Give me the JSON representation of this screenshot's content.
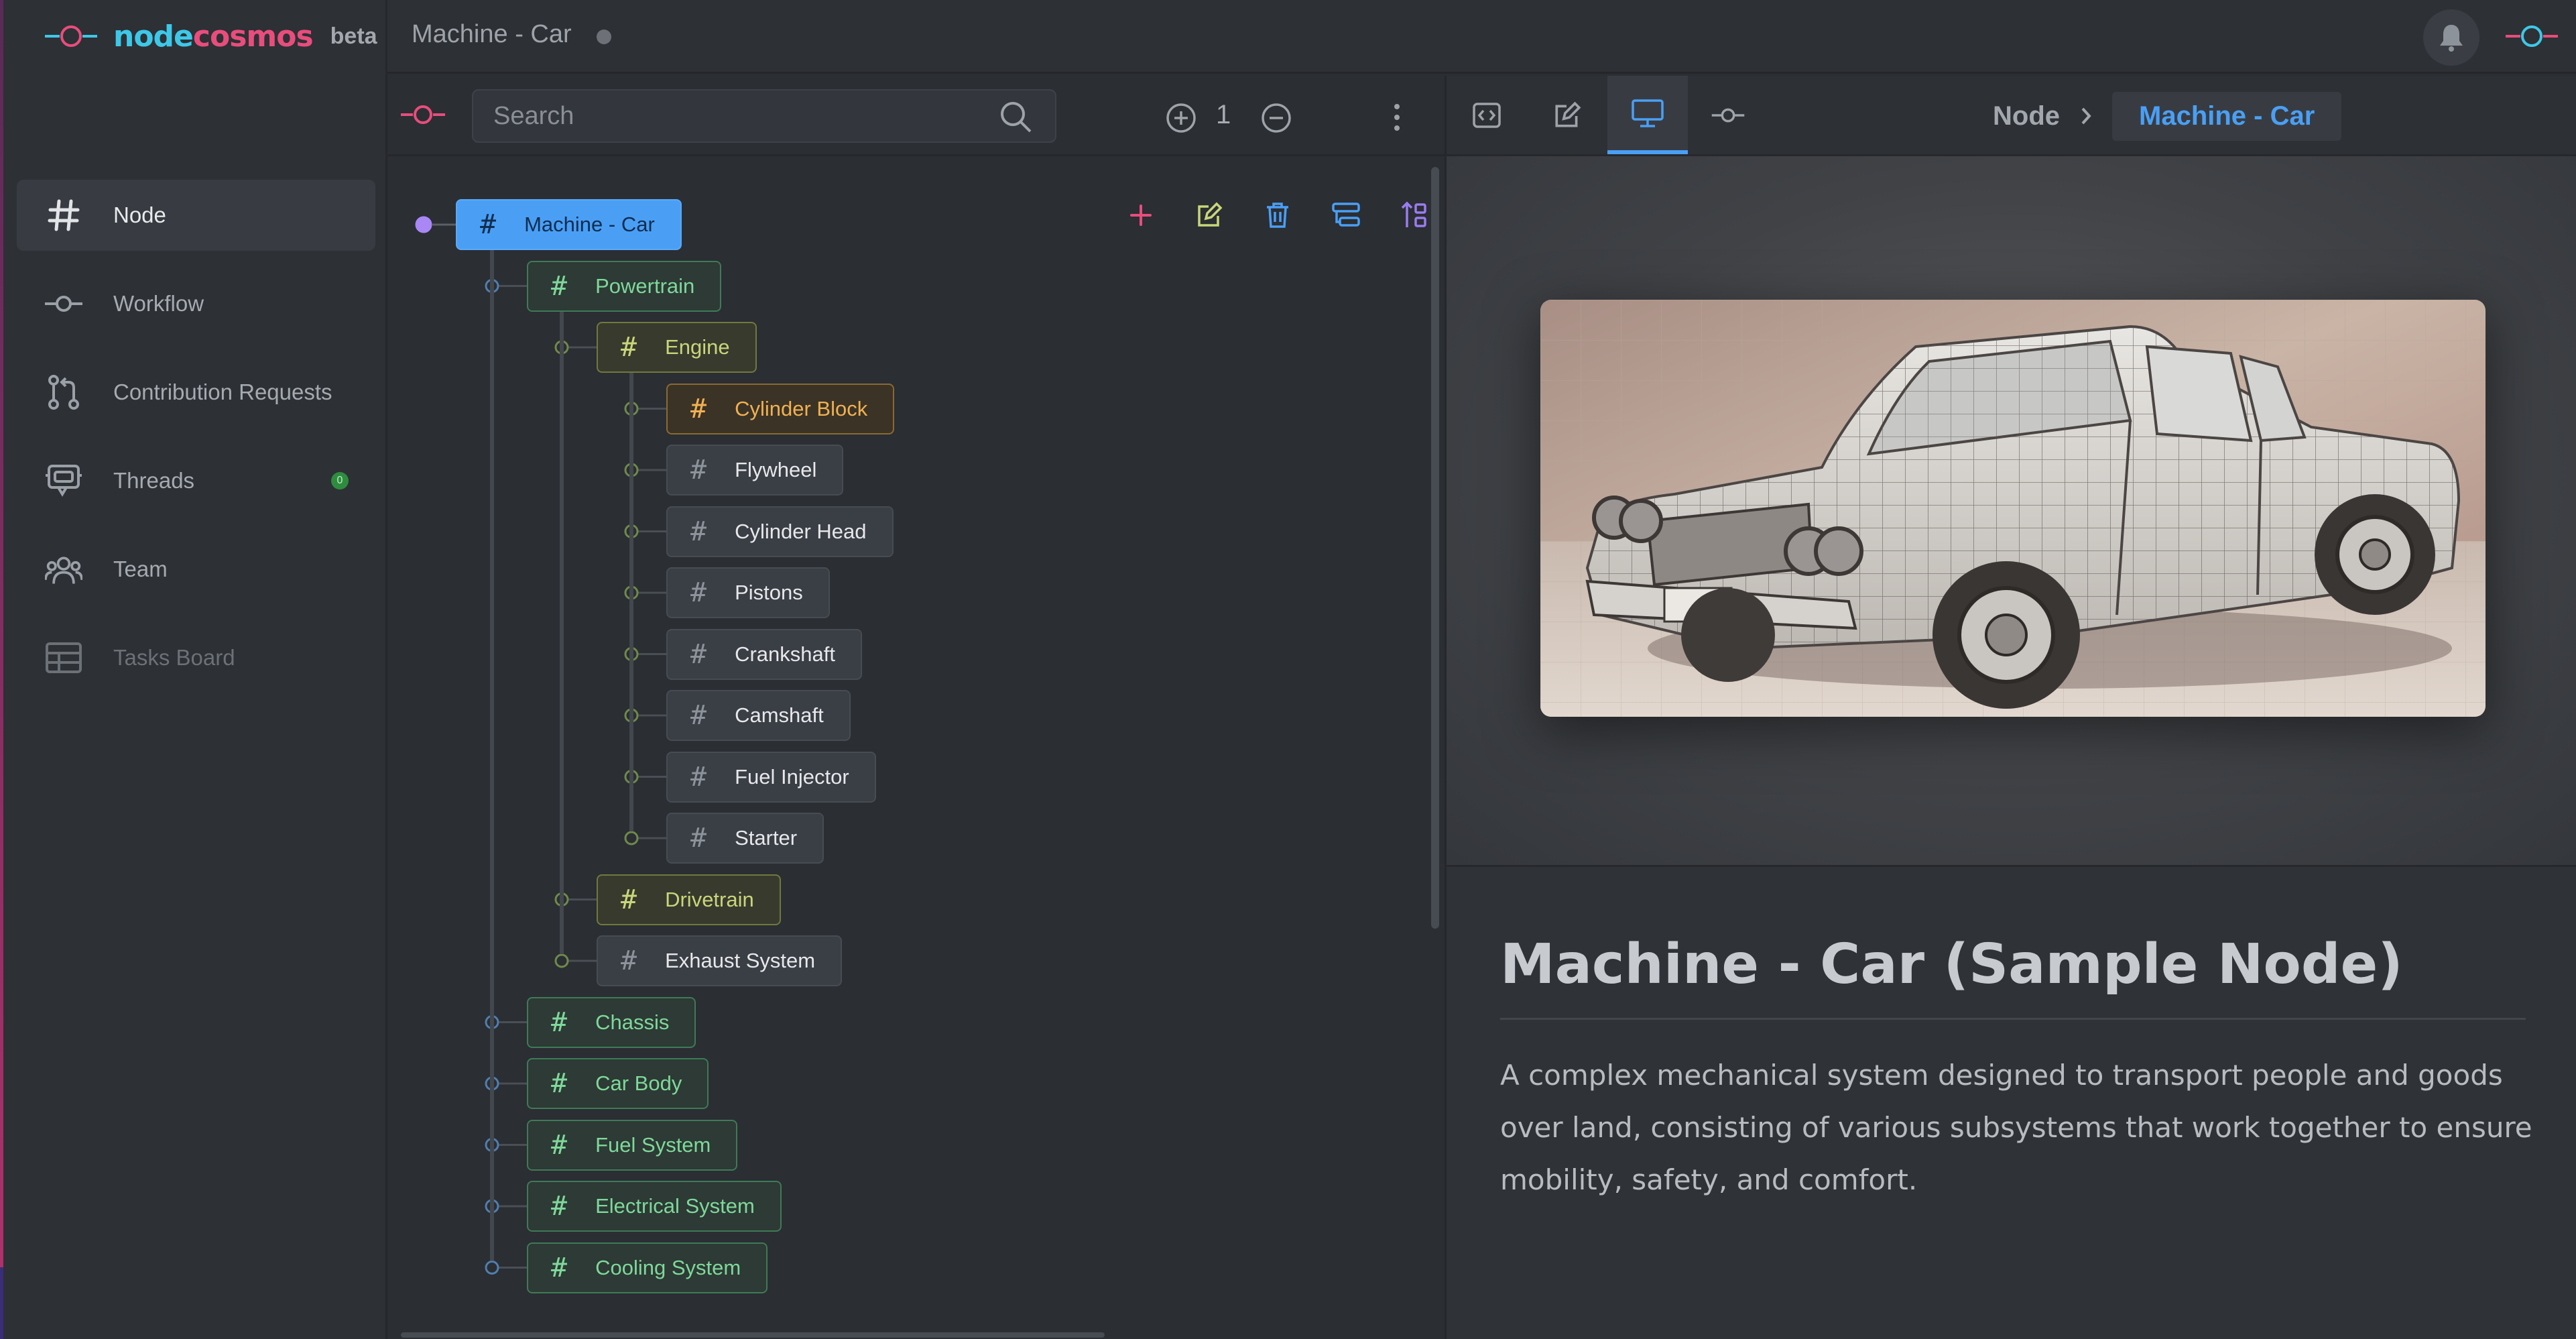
{
  "app": {
    "brand_part1": "node",
    "brand_part2": "cosmos",
    "beta_label": "beta",
    "window_title": "Machine - Car"
  },
  "sidebar": {
    "items": [
      {
        "label": "Node",
        "icon": "hash-icon",
        "active": true
      },
      {
        "label": "Workflow",
        "icon": "workflow-icon"
      },
      {
        "label": "Contribution Requests",
        "icon": "git-pull-request-icon"
      },
      {
        "label": "Threads",
        "icon": "chat-bubble-icon",
        "badge": "0"
      },
      {
        "label": "Team",
        "icon": "team-icon"
      },
      {
        "label": "Tasks Board",
        "icon": "table-icon",
        "disabled": true
      }
    ]
  },
  "tree": {
    "search_placeholder": "Search",
    "zoom_level": "1",
    "hash": "#",
    "root": "Machine - Car",
    "like_count": "1",
    "nodes": [
      {
        "label": "Powertrain",
        "depth": 1,
        "style": "green"
      },
      {
        "label": "Engine",
        "depth": 2,
        "style": "olive"
      },
      {
        "label": "Cylinder Block",
        "depth": 3,
        "style": "orange"
      },
      {
        "label": "Flywheel",
        "depth": 3,
        "style": "gray"
      },
      {
        "label": "Cylinder Head",
        "depth": 3,
        "style": "gray"
      },
      {
        "label": "Pistons",
        "depth": 3,
        "style": "gray"
      },
      {
        "label": "Crankshaft",
        "depth": 3,
        "style": "gray"
      },
      {
        "label": "Camshaft",
        "depth": 3,
        "style": "gray"
      },
      {
        "label": "Fuel Injector",
        "depth": 3,
        "style": "gray"
      },
      {
        "label": "Starter",
        "depth": 3,
        "style": "gray"
      },
      {
        "label": "Drivetrain",
        "depth": 2,
        "style": "olive"
      },
      {
        "label": "Exhaust System",
        "depth": 2,
        "style": "gray"
      },
      {
        "label": "Chassis",
        "depth": 1,
        "style": "green"
      },
      {
        "label": "Car Body",
        "depth": 1,
        "style": "green"
      },
      {
        "label": "Fuel System",
        "depth": 1,
        "style": "green"
      },
      {
        "label": "Electrical System",
        "depth": 1,
        "style": "green"
      },
      {
        "label": "Cooling System",
        "depth": 1,
        "style": "green"
      }
    ]
  },
  "details": {
    "breadcrumb_parent": "Node",
    "breadcrumb_current": "Machine - Car",
    "title": "Machine - Car (Sample Node)",
    "description": "A complex mechanical system designed to transport people and goods over land, consisting of various subsystems that work together to ensure mobility, safety, and comfort."
  },
  "colors": {
    "accent": "#4a9ff5",
    "brand_cyan": "#3ec8e8",
    "brand_pink": "#e84d7c",
    "like": "#e85a7d"
  }
}
